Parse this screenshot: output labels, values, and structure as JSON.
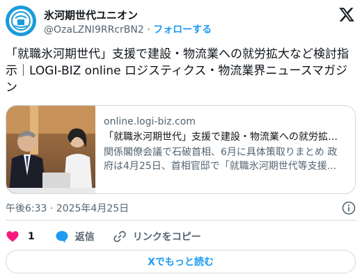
{
  "author": {
    "name": "氷河期世代ユニオン",
    "handle": "@OzaLZNI9RRcrBN2",
    "separator": "·",
    "follow_label": "フォローする",
    "avatar_icon": "union-logo-icon"
  },
  "tweet": {
    "text": "「就職氷河期世代」支援で建設・物流業への就労拡大など検討指示｜LOGI-BIZ online ロジスティクス・物流業界ニュースマガジン"
  },
  "link_card": {
    "domain": "online.logi-biz.com",
    "title": "「就職氷河期世代」支援で建設・物流業への就労拡大など検討指示",
    "description": "関係閣僚会議で石破首相、6月に具体策取りまとめ 政府は4月25日、首相官邸で「就職氷河期世代等支援..."
  },
  "meta": {
    "timestamp": "午後6:33 · 2025年4月25日"
  },
  "actions": {
    "like_count": "1",
    "reply_label": "返信",
    "copy_link_label": "リンクをコピー"
  },
  "read_more_label": "Xでもっと読む",
  "colors": {
    "accent": "#1d9bf0",
    "like": "#f91880",
    "text": "#0f1419",
    "muted": "#536471",
    "border": "#cfd9de"
  }
}
